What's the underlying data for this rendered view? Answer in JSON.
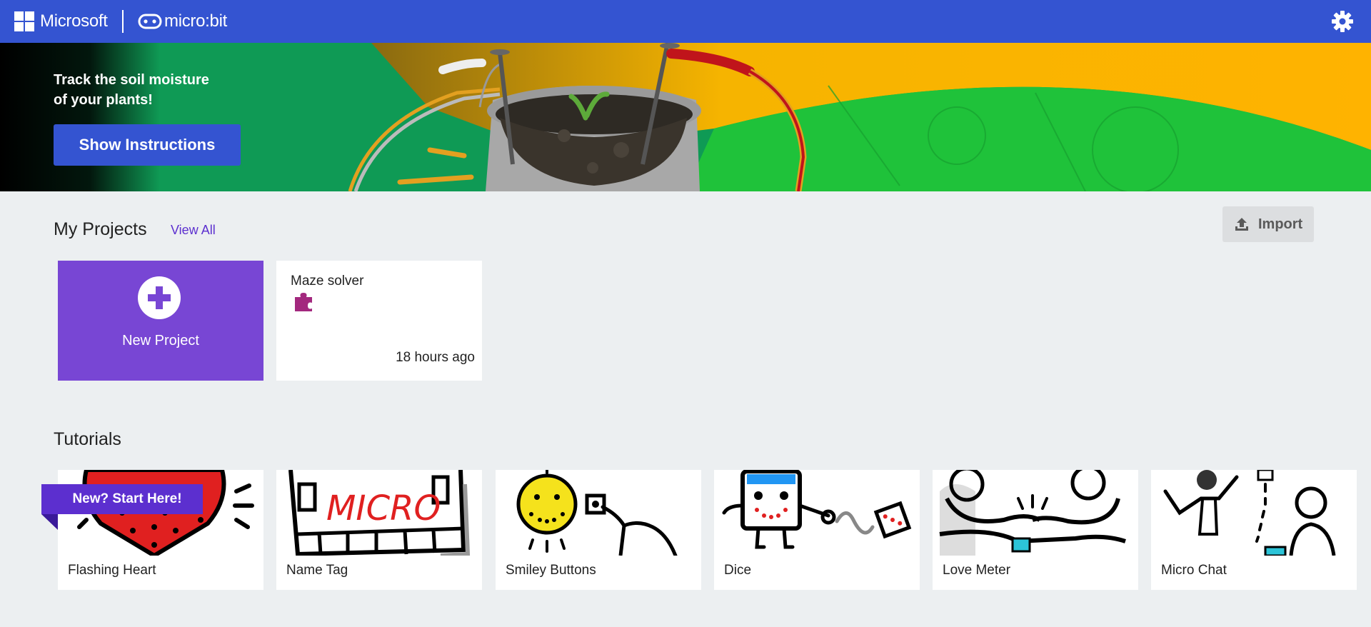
{
  "header": {
    "brand_microsoft": "Microsoft",
    "brand_microbit": "micro:bit",
    "settings_icon": "gear-icon",
    "bar_color": "#3454D1"
  },
  "hero": {
    "headline_line1": "Track the soil moisture",
    "headline_line2": "of your plants!",
    "button_label": "Show Instructions"
  },
  "projects": {
    "title": "My Projects",
    "view_all": "View All",
    "import_label": "Import",
    "new_project_label": "New Project",
    "items": [
      {
        "name": "Maze solver",
        "time": "18 hours ago",
        "icon": "puzzle-piece-icon"
      }
    ]
  },
  "tutorials": {
    "title": "Tutorials",
    "ribbon": "New? Start Here!",
    "items": [
      {
        "name": "Flashing Heart"
      },
      {
        "name": "Name Tag"
      },
      {
        "name": "Smiley Buttons"
      },
      {
        "name": "Dice"
      },
      {
        "name": "Love Meter"
      },
      {
        "name": "Micro Chat"
      }
    ]
  },
  "colors": {
    "accent": "#3454D1",
    "purple": "#7846D4",
    "ribbon": "#5C2FCF",
    "background": "#ECEFF1"
  }
}
